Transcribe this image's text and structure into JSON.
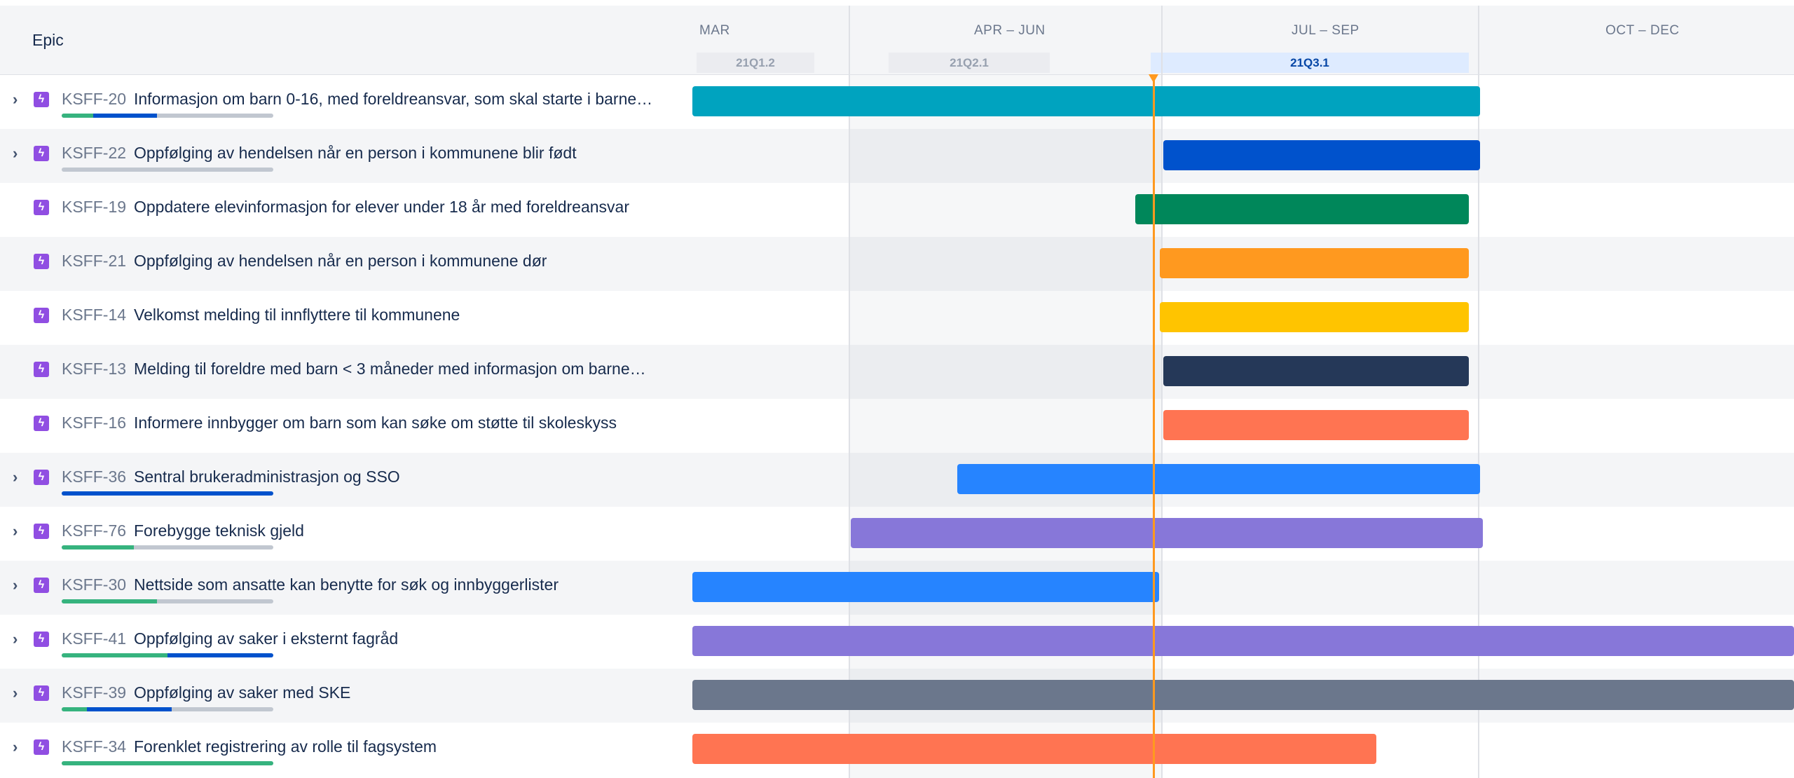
{
  "header": {
    "epic_column": "Epic"
  },
  "timeline": {
    "months": [
      "MAR",
      "APR – JUN",
      "JUL – SEP",
      "OCT – DEC"
    ],
    "sprints": [
      "21Q1.2",
      "21Q2.1",
      "21Q3.1"
    ],
    "active_sprint": "21Q3.1"
  },
  "epics": [
    {
      "key": "KSFF-20",
      "summary": "Informasjon om barn 0-16, med foreldreansvar, som skal starte i barne…",
      "expandable": true,
      "progress": {
        "done": 0.15,
        "in_progress": 0.3
      },
      "color": "#00a3bf"
    },
    {
      "key": "KSFF-22",
      "summary": "Oppfølging av hendelsen når en person i kommunene blir født",
      "expandable": true,
      "progress": {
        "done": 0,
        "in_progress": 0
      },
      "color": "#0052cc"
    },
    {
      "key": "KSFF-19",
      "summary": "Oppdatere elevinformasjon for elever under 18 år med foreldreansvar",
      "expandable": false,
      "progress": null,
      "color": "#00875a"
    },
    {
      "key": "KSFF-21",
      "summary": "Oppfølging av hendelsen når en person i kommunene dør",
      "expandable": false,
      "progress": null,
      "color": "#ff991f"
    },
    {
      "key": "KSFF-14",
      "summary": "Velkomst melding til innflyttere til kommunene",
      "expandable": false,
      "progress": null,
      "color": "#ffc400"
    },
    {
      "key": "KSFF-13",
      "summary": "Melding til foreldre med barn < 3 måneder med informasjon om barne…",
      "expandable": false,
      "progress": null,
      "color": "#253858"
    },
    {
      "key": "KSFF-16",
      "summary": "Informere innbygger om barn som kan søke om støtte til skoleskyss",
      "expandable": false,
      "progress": null,
      "color": "#ff7452"
    },
    {
      "key": "KSFF-36",
      "summary": "Sentral brukeradministrasjon og SSO",
      "expandable": true,
      "progress": {
        "done": 0,
        "in_progress": 1.0
      },
      "color": "#2684ff"
    },
    {
      "key": "KSFF-76",
      "summary": "Forebygge teknisk gjeld",
      "expandable": true,
      "progress": {
        "done": 0.34,
        "in_progress": 0
      },
      "color": "#8777d9"
    },
    {
      "key": "KSFF-30",
      "summary": "Nettside som ansatte kan benytte for søk og innbyggerlister",
      "expandable": true,
      "progress": {
        "done": 0.45,
        "in_progress": 0
      },
      "color": "#2684ff"
    },
    {
      "key": "KSFF-41",
      "summary": "Oppfølging av saker i eksternt fagråd",
      "expandable": true,
      "progress": {
        "done": 0.5,
        "in_progress": 0.5
      },
      "color": "#8777d9"
    },
    {
      "key": "KSFF-39",
      "summary": "Oppfølging av saker med SKE",
      "expandable": true,
      "progress": {
        "done": 0.12,
        "in_progress": 0.4
      },
      "color": "#6b778c"
    },
    {
      "key": "KSFF-34",
      "summary": "Forenklet registrering av rolle til fagsystem",
      "expandable": true,
      "progress": {
        "done": 1.0,
        "in_progress": 0
      },
      "color": "#ff7452"
    }
  ]
}
